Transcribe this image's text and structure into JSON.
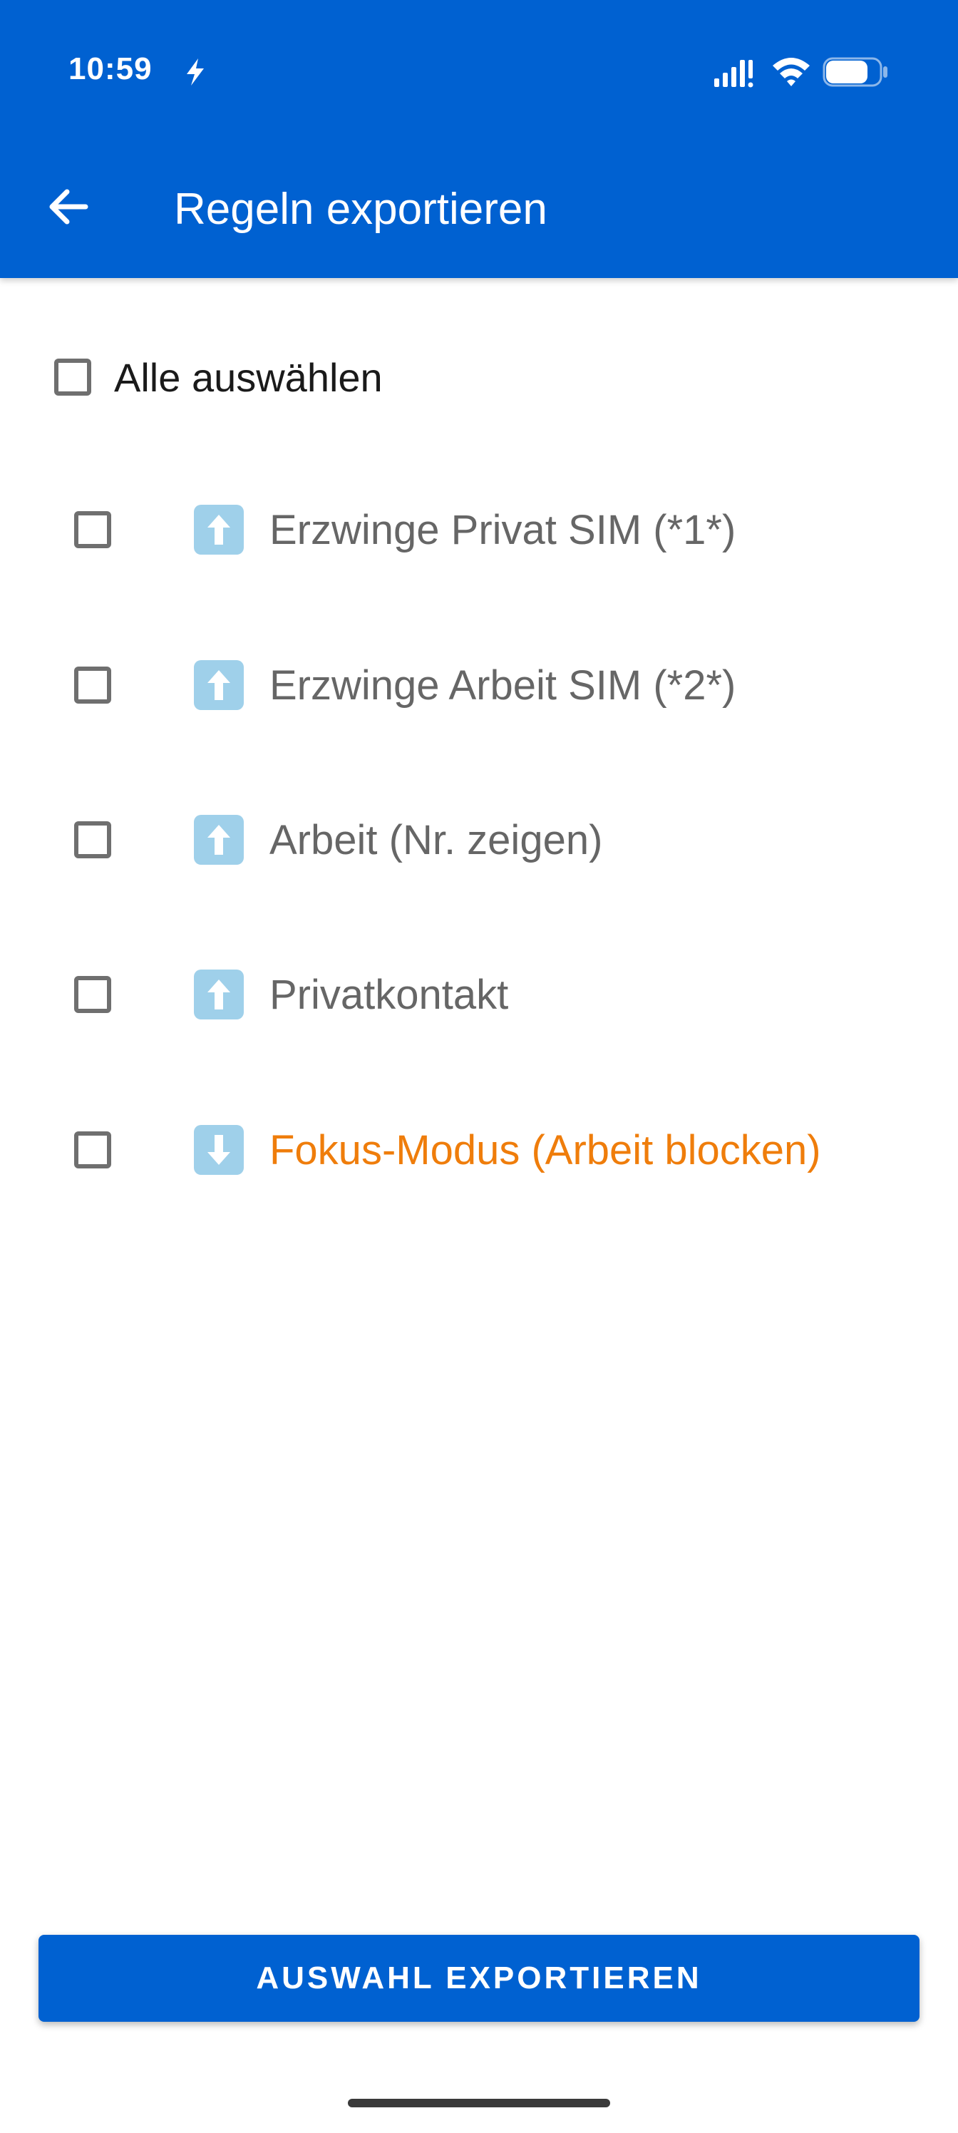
{
  "status_bar": {
    "time": "10:59"
  },
  "header": {
    "title": "Regeln exportieren",
    "background_color": "#0061d1"
  },
  "select_all": {
    "label": "Alle auswählen",
    "checked": false
  },
  "rules": [
    {
      "label": "Erzwinge Privat SIM (*1*)",
      "direction_icon": "arrow-up-icon",
      "color": "#666666",
      "checked": false
    },
    {
      "label": "Erzwinge Arbeit SIM (*2*)",
      "direction_icon": "arrow-up-icon",
      "color": "#666666",
      "checked": false
    },
    {
      "label": "Arbeit (Nr. zeigen)",
      "direction_icon": "arrow-up-icon",
      "color": "#666666",
      "checked": false
    },
    {
      "label": "Privatkontakt",
      "direction_icon": "arrow-up-icon",
      "color": "#666666",
      "checked": false
    },
    {
      "label": "Fokus-Modus (Arbeit blocken)",
      "direction_icon": "arrow-down-icon",
      "color": "#ef7d0b",
      "checked": false
    }
  ],
  "footer": {
    "export_button_label": "AUSWAHL EXPORTIEREN"
  }
}
